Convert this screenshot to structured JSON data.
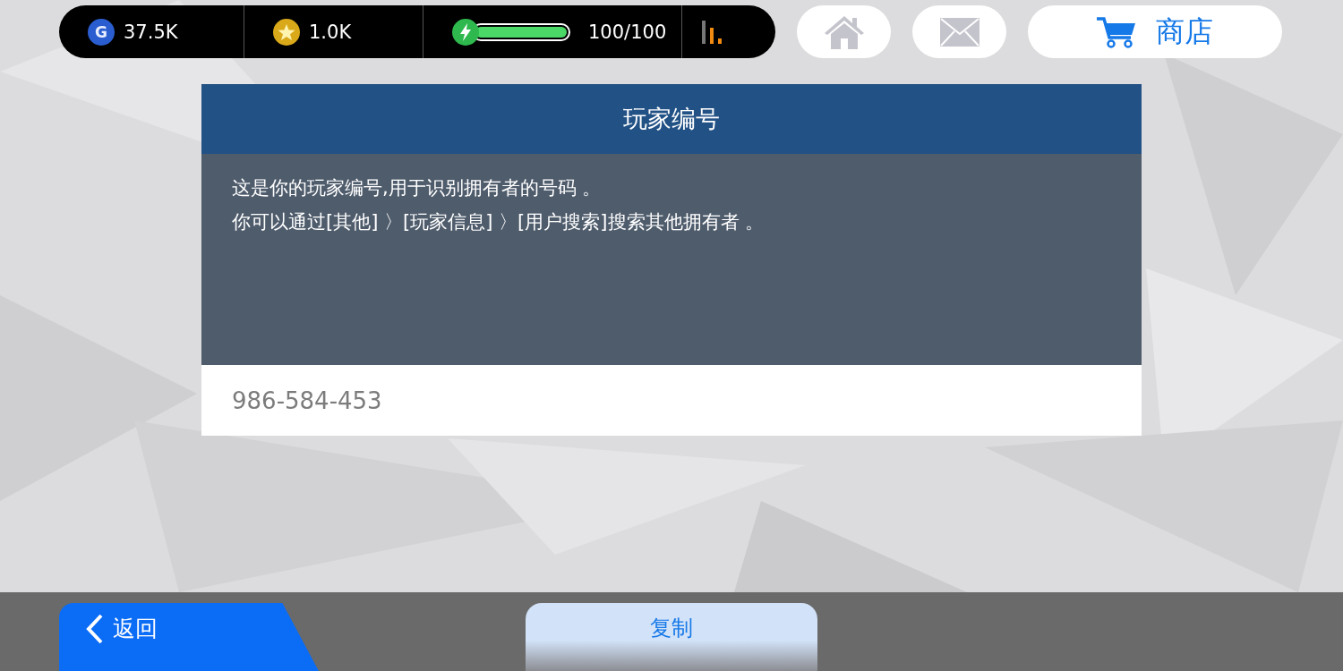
{
  "status_bar": {
    "gold": {
      "icon_letter": "G",
      "value": "37.5K"
    },
    "stars": {
      "value": "1.0K"
    },
    "energy": {
      "level": 1.0,
      "value": "100/100"
    }
  },
  "nav": {
    "shop_label": "商店"
  },
  "panel": {
    "title": "玩家编号",
    "lines": [
      "这是你的玩家编号,用于识别拥有者的号码 。",
      "你可以通过[其他] 〉[玩家信息] 〉[用户搜索]搜索其他拥有者 。"
    ],
    "player_id": "986-584-453"
  },
  "footer": {
    "back_label": "返回",
    "copy_label": "复制"
  }
}
